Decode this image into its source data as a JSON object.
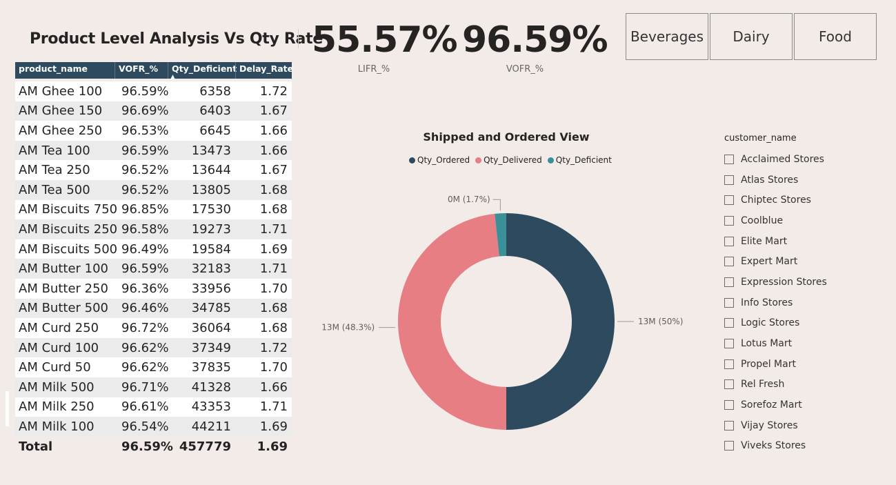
{
  "header": {
    "title": "Product Level Analysis Vs Qty Rate"
  },
  "kpis": [
    {
      "value": "55.57%",
      "label": "LIFR_%"
    },
    {
      "value": "96.59%",
      "label": "VOFR_%"
    }
  ],
  "category_buttons": [
    "Beverages",
    "Dairy",
    "Food"
  ],
  "table": {
    "columns": [
      "product_name",
      "VOFR_%",
      "Qty_Deficient",
      "Delay_Rate"
    ],
    "sort_indicator": "▲",
    "rows": [
      [
        "AM Ghee 100",
        "96.59%",
        "6358",
        "1.72"
      ],
      [
        "AM Ghee 150",
        "96.69%",
        "6403",
        "1.67"
      ],
      [
        "AM Ghee 250",
        "96.53%",
        "6645",
        "1.66"
      ],
      [
        "AM Tea 100",
        "96.59%",
        "13473",
        "1.66"
      ],
      [
        "AM Tea 250",
        "96.52%",
        "13644",
        "1.67"
      ],
      [
        "AM Tea 500",
        "96.52%",
        "13805",
        "1.68"
      ],
      [
        "AM Biscuits 750",
        "96.85%",
        "17530",
        "1.68"
      ],
      [
        "AM Biscuits 250",
        "96.58%",
        "19273",
        "1.71"
      ],
      [
        "AM Biscuits 500",
        "96.49%",
        "19584",
        "1.69"
      ],
      [
        "AM Butter 100",
        "96.59%",
        "32183",
        "1.71"
      ],
      [
        "AM Butter 250",
        "96.36%",
        "33956",
        "1.70"
      ],
      [
        "AM Butter 500",
        "96.46%",
        "34785",
        "1.68"
      ],
      [
        "AM Curd 250",
        "96.72%",
        "36064",
        "1.68"
      ],
      [
        "AM Curd 100",
        "96.62%",
        "37349",
        "1.72"
      ],
      [
        "AM Curd 50",
        "96.62%",
        "37835",
        "1.70"
      ],
      [
        "AM Milk 500",
        "96.71%",
        "41328",
        "1.66"
      ],
      [
        "AM Milk 250",
        "96.61%",
        "43353",
        "1.71"
      ],
      [
        "AM Milk 100",
        "96.54%",
        "44211",
        "1.69"
      ]
    ],
    "total": [
      "Total",
      "96.59%",
      "457779",
      "1.69"
    ]
  },
  "chart_data": {
    "type": "pie",
    "title": "Shipped and Ordered View",
    "legend_position": "top",
    "series": [
      {
        "name": "Qty_Ordered",
        "percent": 50,
        "label": "13M (50%)",
        "color": "#2e4a5e"
      },
      {
        "name": "Qty_Delivered",
        "percent": 48.3,
        "label": "13M (48.3%)",
        "color": "#e67e83"
      },
      {
        "name": "Qty_Deficient",
        "percent": 1.7,
        "label": "0M (1.7%)",
        "color": "#3a8f98"
      }
    ]
  },
  "slicer": {
    "title": "customer_name",
    "items": [
      "Acclaimed Stores",
      "Atlas Stores",
      "Chiptec Stores",
      "Coolblue",
      "Elite Mart",
      "Expert Mart",
      "Expression Stores",
      "Info Stores",
      "Logic Stores",
      "Lotus Mart",
      "Propel Mart",
      "Rel Fresh",
      "Sorefoz Mart",
      "Vijay Stores",
      "Viveks Stores"
    ]
  }
}
